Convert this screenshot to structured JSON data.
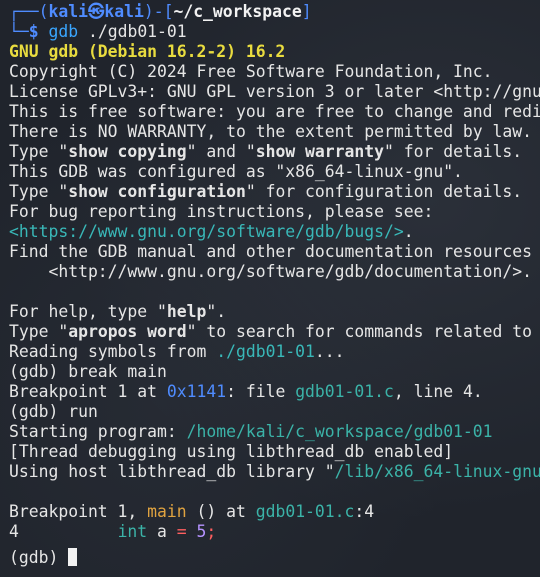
{
  "prompt": {
    "frame_left": "┌──(",
    "user": "kali",
    "at_symbol": "㉿",
    "host": "kali",
    "frame_mid": ")-[",
    "path": "~/c_workspace",
    "frame_right": "]",
    "corner": "└─",
    "dollar": "$",
    "command": "gdb",
    "arg": " ./gdb01-01"
  },
  "gdb_title": "GNU gdb (Debian 16.2-2) 16.2",
  "lines": {
    "copyright": "Copyright (C) 2024 Free Software Foundation, Inc.",
    "license": "License GPLv3+: GNU GPL version 3 or later <http://gnu",
    "free": "This is free software: you are free to change and redi",
    "warranty": "There is NO WARRANTY, to the extent permitted by law.",
    "type_prefix": "Type \"",
    "show_copying": "show copying",
    "and_mid": "\" and \"",
    "show_warranty": "show warranty",
    "details_suffix": "\" for details.",
    "configured": "This GDB was configured as \"x86_64-linux-gnu\".",
    "show_configuration": "show configuration",
    "config_suffix": "\" for configuration details.",
    "bug_reporting": "For bug reporting instructions, please see:",
    "bugs_url": "<https://www.gnu.org/software/gdb/bugs/>",
    "bugs_dot": ".",
    "find_manual": "Find the GDB manual and other documentation resources",
    "doc_url": "    <http://www.gnu.org/software/gdb/documentation/>.",
    "help_prefix": "For help, type \"",
    "help_word": "help",
    "help_suffix": "\".",
    "apropos_prefix": "Type \"",
    "apropos_word": "apropos word",
    "apropos_suffix": "\" to search for commands related to",
    "reading_prefix": "Reading symbols from ",
    "reading_file": "./gdb01-01",
    "reading_suffix": "...",
    "break_main": "(gdb) break main",
    "bp_prefix": "Breakpoint 1 at ",
    "bp_addr": "0x1141",
    "bp_mid": ": file ",
    "bp_file": "gdb01-01.c",
    "bp_suffix": ", line 4.",
    "run": "(gdb) run",
    "starting_prefix": "Starting program: ",
    "starting_path": "/home/kali/c_workspace/gdb01-01",
    "thread_debug": "[Thread debugging using libthread_db enabled]",
    "host_lib_prefix": "Using host libthread_db library \"",
    "host_lib_path": "/lib/x86_64-linux-gnu",
    "hit_prefix": "Breakpoint 1, ",
    "hit_func": "main",
    "hit_mid": " () at ",
    "hit_file": "gdb01-01.c",
    "hit_suffix": ":4",
    "src_lineno": "4",
    "src_pad": "          ",
    "src_kw": "int",
    "src_var": " a ",
    "src_eq": "=",
    "src_space": " ",
    "src_num": "5",
    "src_semi": ";",
    "final_prompt": "(gdb) "
  },
  "colors": {
    "background": "#20242c",
    "prompt_blue": "#4f8cff",
    "title_yellow": "#e9dc3f",
    "link_teal": "#39b8b8",
    "func_orange": "#e0a340"
  }
}
